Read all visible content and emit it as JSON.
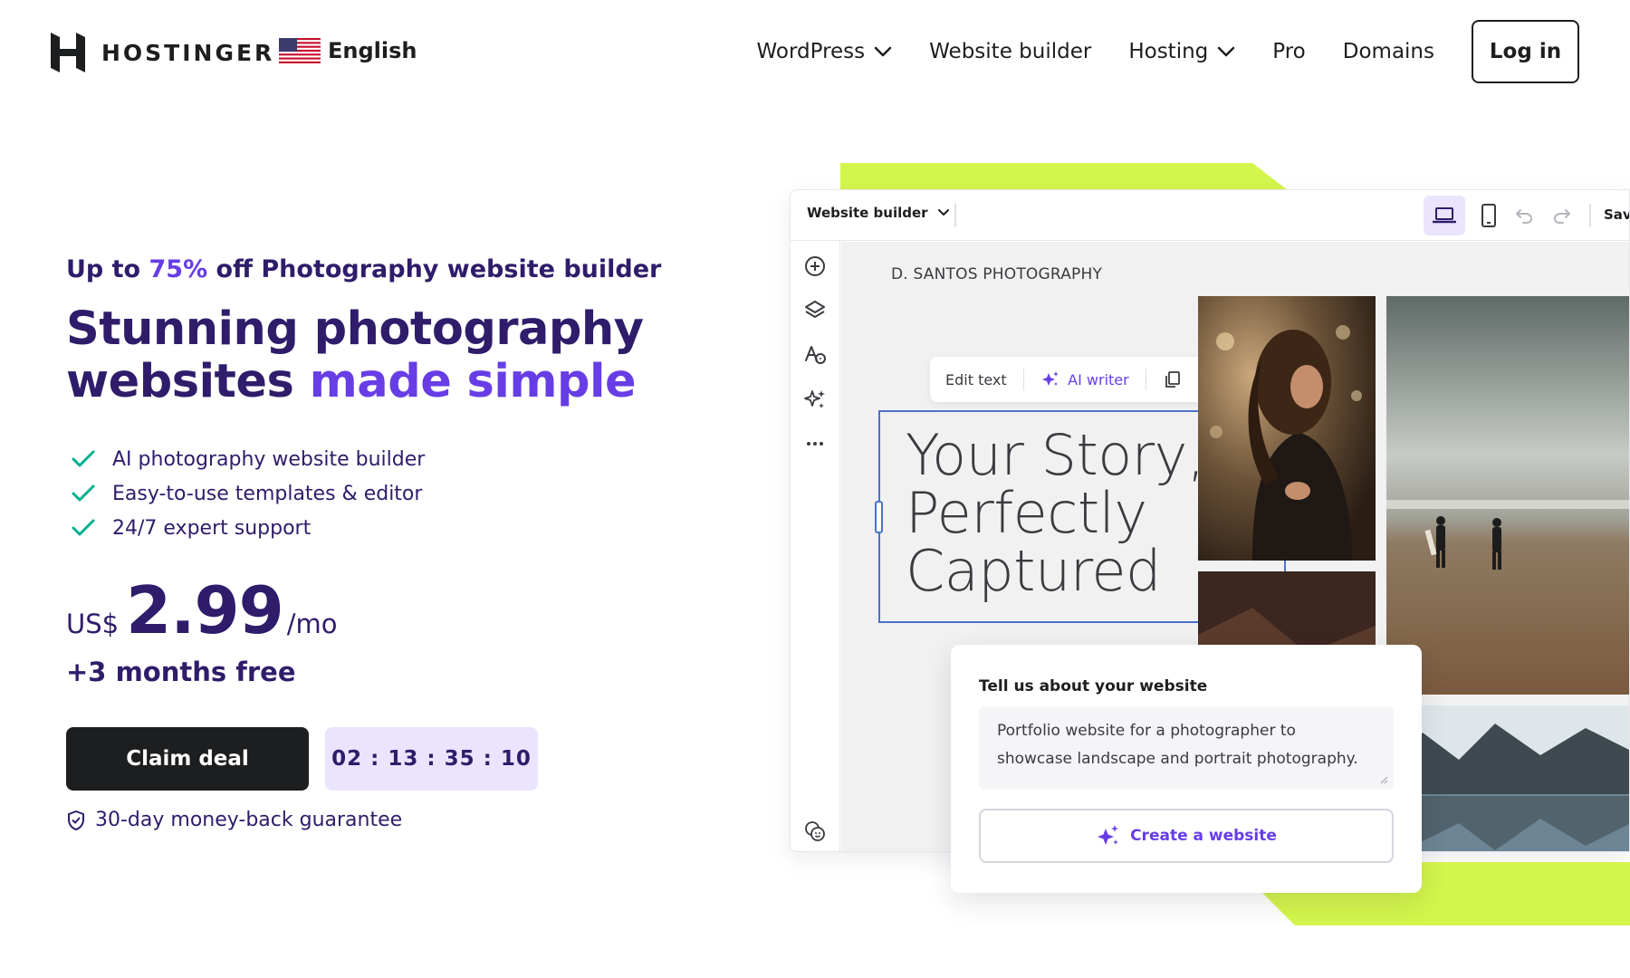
{
  "header": {
    "brand": "HOSTINGER",
    "language": "English",
    "nav": [
      {
        "label": "WordPress",
        "dropdown": true
      },
      {
        "label": "Website builder",
        "dropdown": false
      },
      {
        "label": "Hosting",
        "dropdown": true
      },
      {
        "label": "Pro",
        "dropdown": false
      },
      {
        "label": "Domains",
        "dropdown": false
      }
    ],
    "login_label": "Log in"
  },
  "hero": {
    "promo_prefix": "Up to ",
    "promo_accent": "75%",
    "promo_suffix": " off Photography website builder",
    "title_line1": "Stunning photography",
    "title_line2_plain": "websites ",
    "title_line2_accent": "made simple",
    "features": [
      "AI photography website builder",
      "Easy-to-use templates & editor",
      "24/7 expert support"
    ],
    "price_currency": "US$",
    "price_amount": "2.99",
    "price_period": "/mo",
    "free_months": "+3 months free",
    "claim_label": "Claim deal",
    "timer": "02 : 13 : 35 : 10",
    "guarantee": "30-day money-back guarantee"
  },
  "builder": {
    "title": "Website builder",
    "save_label": "Save",
    "site_name": "D. SANTOS PHOTOGRAPHY",
    "edit_text_label": "Edit text",
    "ai_writer_label": "AI writer",
    "headline_line1": "Your Story,",
    "headline_line2": "Perfectly",
    "headline_line3": "Captured"
  },
  "ai_card": {
    "label": "Tell us about your website",
    "textarea_value": "Portfolio website for a photographer to showcase landscape and portrait photography.",
    "create_label": "Create a website"
  },
  "colors": {
    "brand_purple": "#673de6",
    "dark_navy": "#2f1c6a",
    "lime": "#d4f54c",
    "timer_bg": "#ebe4ff",
    "check_green": "#00b090"
  }
}
